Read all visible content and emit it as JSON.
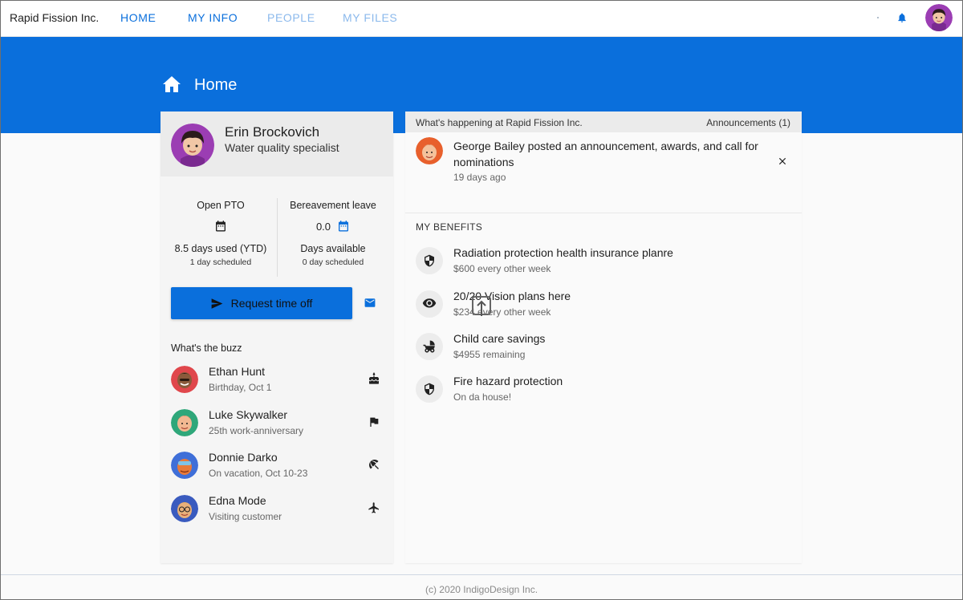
{
  "app": {
    "brand": "Rapid Fission Inc."
  },
  "nav": {
    "items": [
      {
        "label": "HOME",
        "state": "active"
      },
      {
        "label": "MY INFO",
        "state": "normal"
      },
      {
        "label": "PEOPLE",
        "state": "muted"
      },
      {
        "label": "MY FILES",
        "state": "muted"
      }
    ]
  },
  "header": {
    "title": "Home",
    "icon": "home-icon"
  },
  "profile": {
    "name": "Erin Brockovich",
    "role": "Water quality specialist"
  },
  "pto": {
    "open": {
      "title": "Open PTO",
      "main": "8.5 days used (YTD)",
      "sub": "1 day scheduled"
    },
    "bereavement": {
      "title": "Bereavement leave",
      "value": "0.0",
      "main": "Days available",
      "sub": "0 day scheduled"
    }
  },
  "actions": {
    "request_label": "Request time off"
  },
  "buzz": {
    "title": "What's the buzz",
    "items": [
      {
        "name": "Ethan Hunt",
        "detail": "Birthday, Oct 1",
        "icon": "cake-icon"
      },
      {
        "name": "Luke Skywalker",
        "detail": "25th work-anniversary",
        "icon": "flag-icon"
      },
      {
        "name": "Donnie Darko",
        "detail": "On vacation, Oct 10-23",
        "icon": "beach-umbrella-icon"
      },
      {
        "name": "Edna Mode",
        "detail": "Visiting customer",
        "icon": "airplane-icon"
      }
    ]
  },
  "happening": {
    "title": "What's happening at Rapid Fission Inc.",
    "announcements_label": "Announcements (1)",
    "announcement": {
      "text": "George Bailey posted an announcement, awards, and call for nominations",
      "time": "19 days ago"
    }
  },
  "benefits": {
    "title": "MY BENEFITS",
    "items": [
      {
        "name": "Radiation protection health insurance planre",
        "detail": "$600 every other week",
        "icon": "shield-icon"
      },
      {
        "name": "20/20 Vision plans here",
        "detail": "$234 every other week",
        "icon": "eye-icon"
      },
      {
        "name": "Child care savings",
        "detail": "$4955 remaining",
        "icon": "stroller-icon"
      },
      {
        "name": "Fire hazard protection",
        "detail": "On da house!",
        "icon": "shield-icon"
      }
    ]
  },
  "footer": {
    "text": "(c) 2020 IndigoDesign Inc."
  },
  "colors": {
    "primary": "#0a6fdc",
    "nav_muted": "#8bb9ec",
    "card_header": "#ebebeb"
  }
}
